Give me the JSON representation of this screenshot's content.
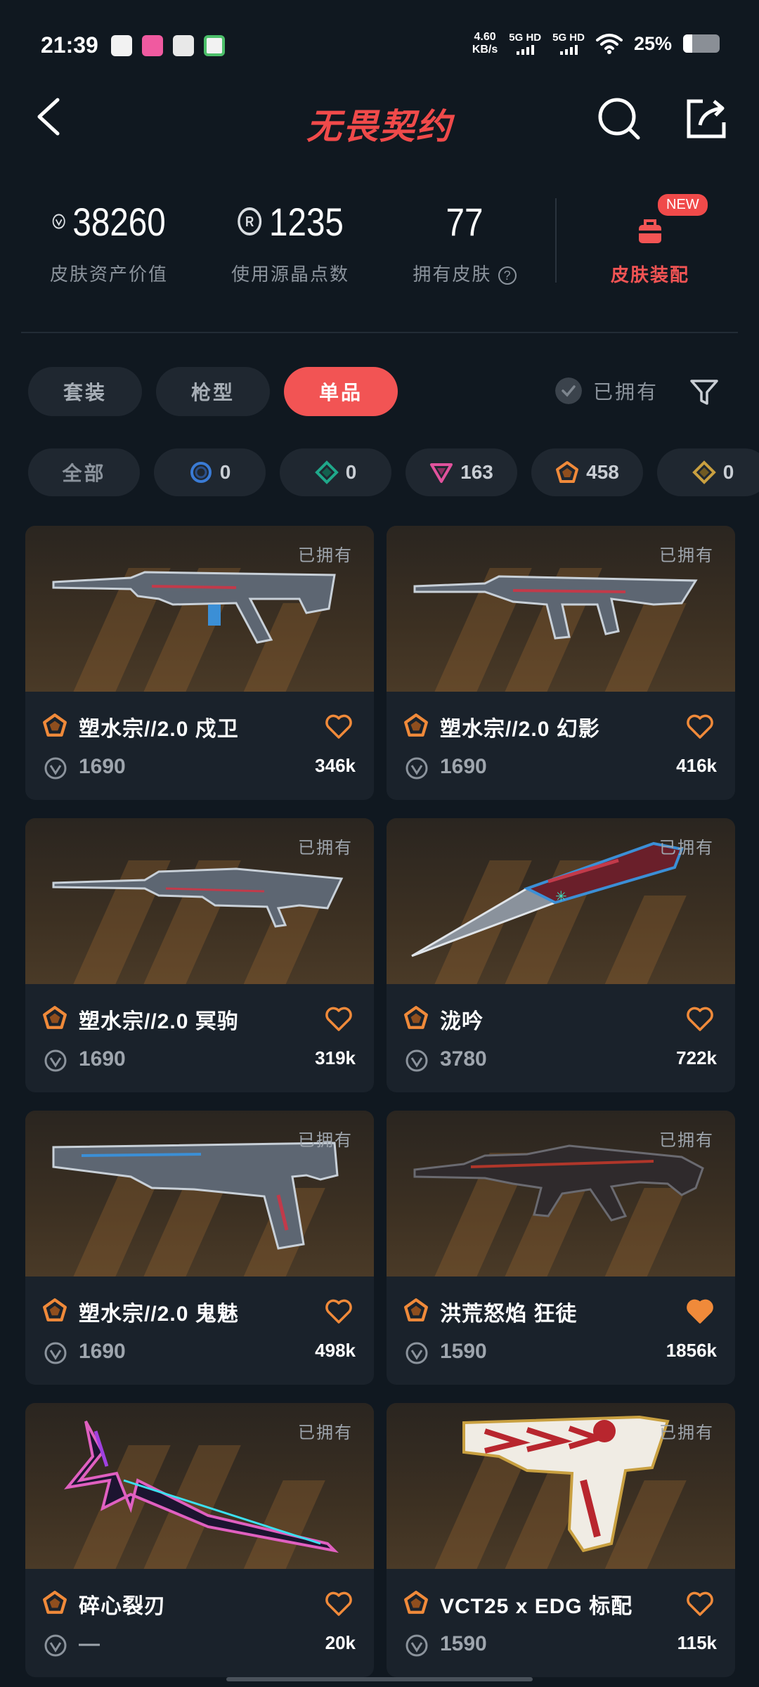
{
  "status_bar": {
    "time": "21:39",
    "speed_value": "4.60",
    "speed_unit": "KB/s",
    "net1": "5G HD",
    "net2": "5G HD",
    "battery_text": "25%",
    "battery_level": 0.25
  },
  "header": {
    "title": "无畏契约"
  },
  "stats": {
    "asset_value": "38260",
    "asset_label": "皮肤资产价值",
    "radianite_value": "1235",
    "radianite_label": "使用源晶点数",
    "owned_value": "77",
    "owned_label": "拥有皮肤",
    "equip_label": "皮肤装配",
    "new_badge": "NEW"
  },
  "tabs": [
    {
      "label": "套装"
    },
    {
      "label": "枪型"
    },
    {
      "label": "单品"
    }
  ],
  "owned_toggle_label": "已拥有",
  "chips": [
    {
      "label": "全部"
    },
    {
      "count": "0",
      "icon": "blue-ring-icon",
      "color": "#3a7bd5"
    },
    {
      "count": "0",
      "icon": "green-diamond-icon",
      "color": "#1fa88a"
    },
    {
      "count": "163",
      "icon": "pink-triangle-icon",
      "color": "#e0529c"
    },
    {
      "count": "458",
      "icon": "orange-pentagon-icon",
      "color": "#f08a3a"
    },
    {
      "count": "0",
      "icon": "gold-diamond-icon",
      "color": "#c9a040"
    }
  ],
  "cards": [
    {
      "name": "塑水宗//2.0 戍卫",
      "price": "1690",
      "likes": "346k",
      "owned": "已拥有",
      "liked": false
    },
    {
      "name": "塑水宗//2.0 幻影",
      "price": "1690",
      "likes": "416k",
      "owned": "已拥有",
      "liked": false
    },
    {
      "name": "塑水宗//2.0 冥驹",
      "price": "1690",
      "likes": "319k",
      "owned": "已拥有",
      "liked": false
    },
    {
      "name": "泷吟",
      "price": "3780",
      "likes": "722k",
      "owned": "已拥有",
      "liked": false
    },
    {
      "name": "塑水宗//2.0 鬼魅",
      "price": "1690",
      "likes": "498k",
      "owned": "已拥有",
      "liked": false
    },
    {
      "name": "洪荒怒焰 狂徒",
      "price": "1590",
      "likes": "1856k",
      "owned": "已拥有",
      "liked": true
    },
    {
      "name": "碎心裂刃",
      "price": "—",
      "likes": "20k",
      "owned": "已拥有",
      "liked": false
    },
    {
      "name": "VCT25 x EDG 标配",
      "price": "1590",
      "likes": "115k",
      "owned": "已拥有",
      "liked": false
    }
  ],
  "colors": {
    "accent": "#f25454",
    "background": "#101820",
    "card": "#1a222b",
    "tier_orange": "#f08a3a"
  }
}
